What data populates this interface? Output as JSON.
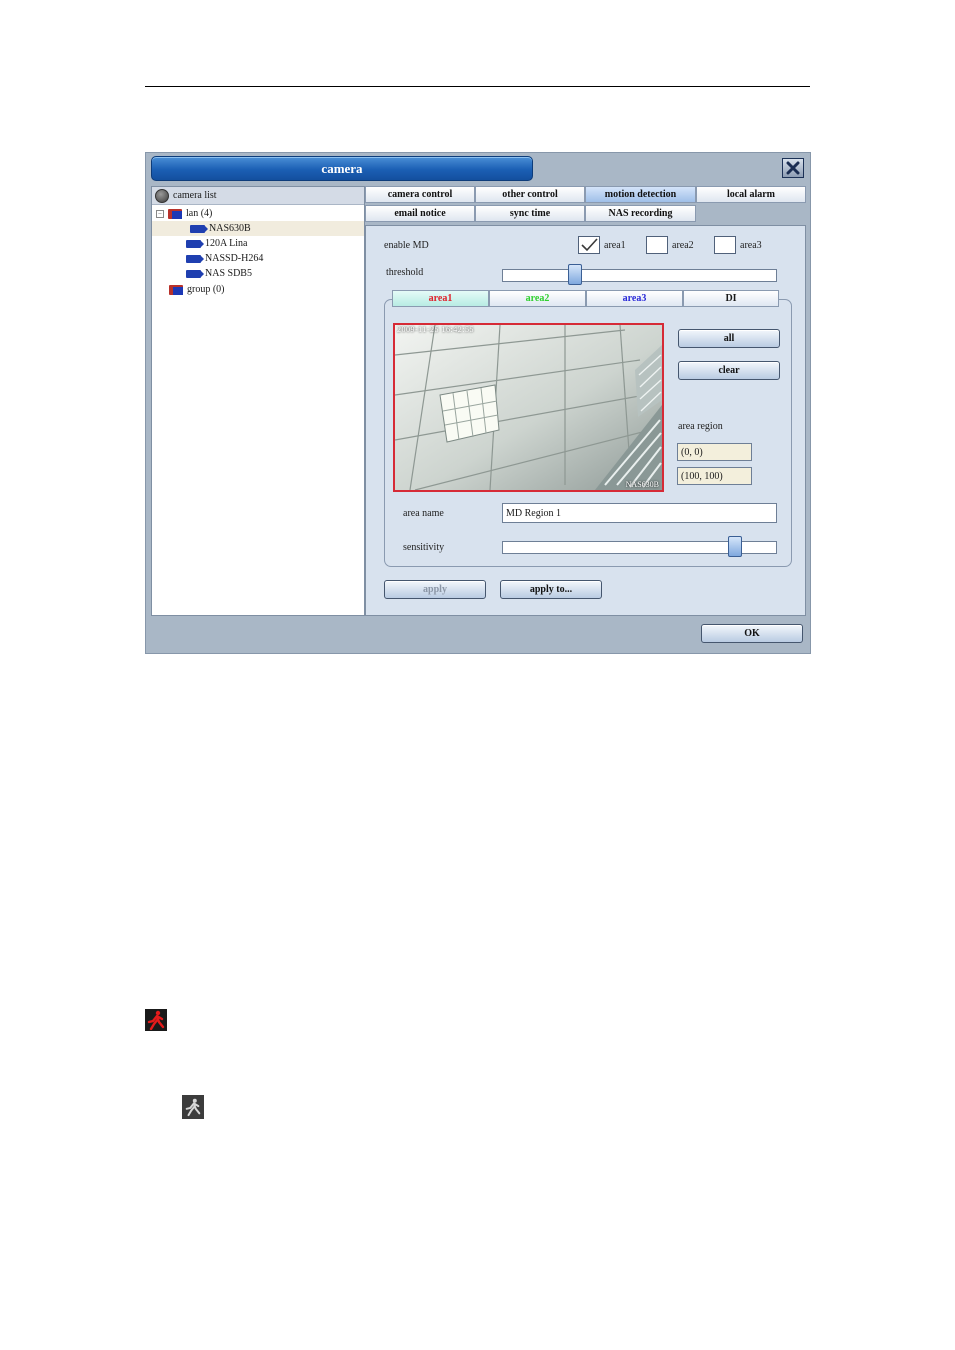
{
  "window": {
    "title": "camera",
    "close_icon": "close-x-icon"
  },
  "camera_list": {
    "header": "camera list",
    "tree": [
      {
        "label": "lan (4)",
        "type": "folder",
        "expanded": true
      },
      {
        "label": "NAS630B",
        "type": "camera",
        "selected": true
      },
      {
        "label": "120A Lina",
        "type": "camera"
      },
      {
        "label": "NASSD-H264",
        "type": "camera"
      },
      {
        "label": "NAS SDB5",
        "type": "camera"
      },
      {
        "label": "group (0)",
        "type": "folder"
      }
    ],
    "expander_symbol": "−"
  },
  "tabs": {
    "row1": [
      "camera control",
      "other control",
      "motion detection",
      "local alarm"
    ],
    "row2": [
      "email notice",
      "sync time",
      "NAS recording"
    ],
    "active": "motion detection"
  },
  "motion_detection": {
    "enable_label": "enable MD",
    "areas": [
      {
        "label": "area1",
        "checked": true
      },
      {
        "label": "area2",
        "checked": false
      },
      {
        "label": "area3",
        "checked": false
      }
    ],
    "threshold_label": "threshold",
    "threshold_level": 0.25,
    "subtabs": [
      {
        "label": "area1",
        "color": "#e0202a",
        "active": true
      },
      {
        "label": "area2",
        "color": "#2fd02f"
      },
      {
        "label": "area3",
        "color": "#2a2ad8"
      },
      {
        "label": "DI",
        "color": "#111111"
      }
    ],
    "video_timestamp": "2009-11-25 16:42:55",
    "video_watermark": "NAS630B",
    "all_button": "all",
    "clear_button": "clear",
    "area_region_label": "area region",
    "region_start": "(0, 0)",
    "region_end": "(100, 100)",
    "area_name_label": "area name",
    "area_name_value": "MD Region 1",
    "sensitivity_label": "sensitivity",
    "sensitivity_level": 0.87,
    "apply_button": "apply",
    "apply_to_button": "apply to..."
  },
  "footer": {
    "ok_button": "OK"
  },
  "page_icons": {
    "active_icon": "motion-alert-red-icon",
    "inactive_icon": "motion-idle-gray-icon"
  }
}
